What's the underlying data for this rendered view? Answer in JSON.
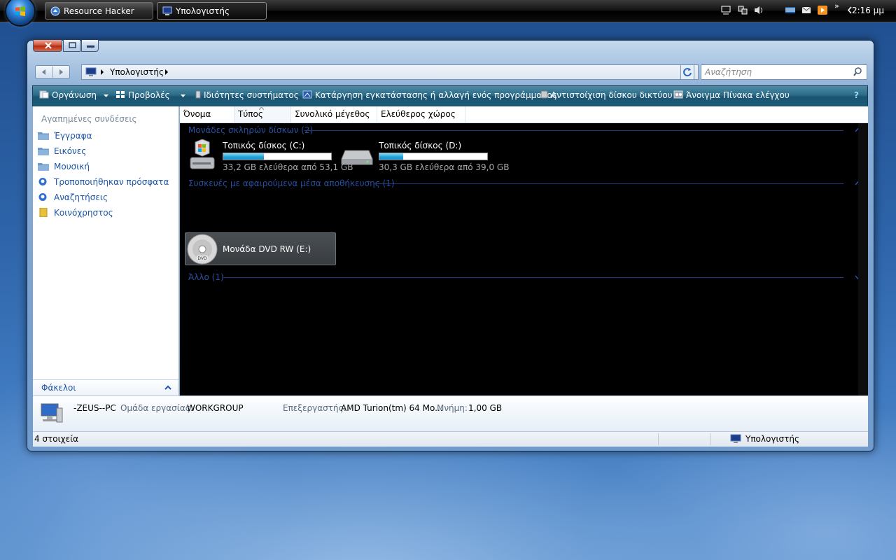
{
  "taskbar": {
    "tasks": [
      {
        "label": "Resource Hacker",
        "icon": "resource-hacker-icon"
      },
      {
        "label": "Υπολογιστής",
        "icon": "computer-icon"
      }
    ],
    "clock": "2:16 μμ",
    "tray_chevrons": "»"
  },
  "window": {
    "address": {
      "crumb": "Υπολογιστής"
    },
    "search_placeholder": "Αναζήτηση",
    "commands": [
      {
        "label": "Οργάνωση",
        "icon": "organize-icon",
        "has_dropdown": true
      },
      {
        "label": "Προβολές",
        "icon": "views-icon",
        "has_dropdown": true
      },
      {
        "label": "Ιδιότητες συστήματος",
        "icon": "system-properties-icon"
      },
      {
        "label": "Κατάργηση εγκατάστασης ή αλλαγή ενός προγράμματος",
        "icon": "uninstall-icon"
      },
      {
        "label": "Αντιστοίχιση δίσκου δικτύου",
        "icon": "map-drive-icon"
      },
      {
        "label": "Άνοιγμα Πίνακα ελέγχου",
        "icon": "control-panel-icon"
      }
    ],
    "nav": {
      "favorites_title": "Αγαπημένες συνδέσεις",
      "favorites": [
        {
          "label": "Έγγραφα",
          "icon": "folder-icon"
        },
        {
          "label": "Εικόνες",
          "icon": "folder-icon"
        },
        {
          "label": "Μουσική",
          "icon": "folder-icon"
        },
        {
          "label": "Τροποποιήθηκαν πρόσφατα",
          "icon": "search-folder-icon"
        },
        {
          "label": "Αναζητήσεις",
          "icon": "search-folder-icon"
        },
        {
          "label": "Κοινόχρηστος",
          "icon": "public-folder-icon"
        }
      ],
      "folders_label": "Φάκελοι"
    },
    "columns": [
      "Όνομα",
      "Τύπος",
      "Συνολικό μέγεθος",
      "Ελεύθερος χώρος"
    ],
    "groups": [
      {
        "title": "Μονάδες σκληρών δίσκων (2)"
      },
      {
        "title": "Συσκευές με αφαιρούμενα μέσα αποθήκευσης (1)"
      },
      {
        "title": "Άλλο (1)"
      }
    ],
    "drives": [
      {
        "name": "Τοπικός δίσκος (C:)",
        "free_text": "33,2 GB ελεύθερα από 53,1 GB",
        "used_fraction": 0.375
      },
      {
        "name": "Τοπικός δίσκος (D:)",
        "free_text": "30,3 GB ελεύθερα από 39,0 GB",
        "used_fraction": 0.223
      }
    ],
    "dvd": {
      "name": "Μονάδα DVD RW (E:)",
      "disc_label": "DVD"
    },
    "details": {
      "computer_name": "-ZEUS--PC",
      "workgroup_key": "Ομάδα εργασίας:",
      "workgroup_val": "WORKGROUP",
      "cpu_key": "Επεξεργαστής:",
      "cpu_val": "AMD Turion(tm) 64 Mo...",
      "ram_key": "Μνήμη:",
      "ram_val": "1,00 GB"
    },
    "status": {
      "count": "4 στοιχεία",
      "location": "Υπολογιστής"
    }
  },
  "colors": {
    "accent": "#1d55a6",
    "group_text": "#2b4f9e",
    "content_bg": "#000000"
  }
}
